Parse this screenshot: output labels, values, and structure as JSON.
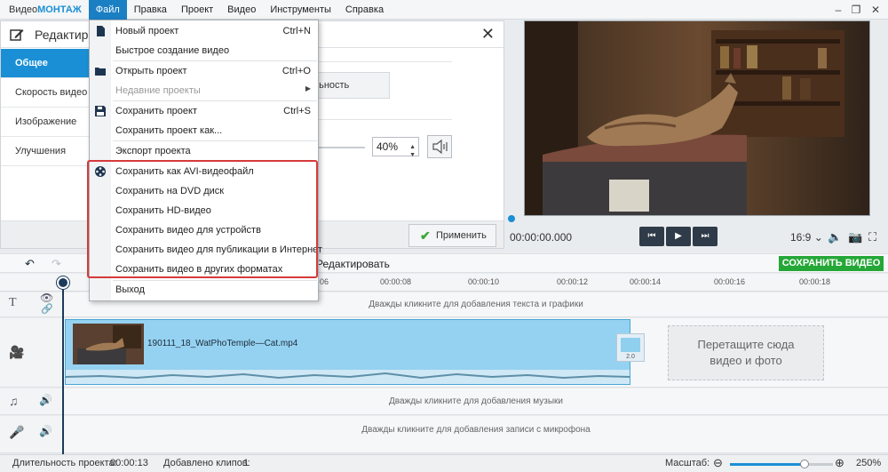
{
  "app": {
    "logo_light": "Видео",
    "logo_bold": "МОНТАЖ"
  },
  "menu": [
    "Файл",
    "Правка",
    "Проект",
    "Видео",
    "Инструменты",
    "Справка"
  ],
  "window": {
    "minimize": "–",
    "maximize": "❐",
    "close": "✕"
  },
  "edit_panel": {
    "title": "Редактиро",
    "close": "✕",
    "sidebar": [
      "Общее",
      "Скорость видео",
      "Изображение",
      "Улучшения"
    ],
    "button_partial": "тельность",
    "percent_value": "40%",
    "apply_label": "Применить"
  },
  "file_menu": {
    "items": [
      {
        "label": "Новый проект",
        "shortcut": "Ctrl+N",
        "icon": "new-file-icon"
      },
      {
        "label": "Быстрое создание видео",
        "shortcut": ""
      },
      {
        "label": "Открыть проект",
        "shortcut": "Ctrl+O",
        "icon": "folder-icon"
      },
      {
        "label": "Недавние проекты",
        "shortcut": "",
        "disabled": true,
        "submenu": true
      },
      {
        "label": "Сохранить проект",
        "shortcut": "Ctrl+S",
        "icon": "save-icon"
      },
      {
        "label": "Сохранить проект как...",
        "shortcut": ""
      },
      {
        "label": "Экспорт проекта",
        "shortcut": ""
      },
      {
        "label": "Сохранить как AVI-видеофайл",
        "shortcut": "",
        "icon": "film-reel-icon"
      },
      {
        "label": "Сохранить на DVD диск",
        "shortcut": ""
      },
      {
        "label": "Сохранить HD-видео",
        "shortcut": ""
      },
      {
        "label": "Сохранить видео для устройств",
        "shortcut": ""
      },
      {
        "label": "Сохранить видео для публикации в Интернет",
        "shortcut": ""
      },
      {
        "label": "Сохранить видео в других форматах",
        "shortcut": ""
      },
      {
        "label": "Выход",
        "shortcut": ""
      }
    ]
  },
  "preview": {
    "time": "00:00:00.000",
    "ratio": "16:9 ⌄"
  },
  "toolbar": {
    "edit_label": "Редактировать",
    "save_video": "СОХРАНИТЬ ВИДЕО"
  },
  "timeline": {
    "ticks": [
      "06",
      "00:00:08",
      "00:00:10",
      "00:00:12",
      "00:00:14",
      "00:00:16",
      "00:00:18"
    ],
    "text_hint": "Дважды кликните для добавления текста и графики",
    "clip_name": "190111_18_WatPhoTemple—Cat.mp4",
    "transition_label": "2.0",
    "drop_hint_1": "Перетащите сюда",
    "drop_hint_2": "видео и фото",
    "music_hint": "Дважды кликните для добавления музыки",
    "mic_hint": "Дважды кликните для добавления записи с микрофона"
  },
  "status": {
    "duration_label": "Длительность проекта:",
    "duration_value": "00:00:13",
    "clips_label": "Добавлено клипов:",
    "clips_value": "1",
    "zoom_label": "Масштаб:",
    "zoom_value": "250%",
    "zoom_level_fraction": 0.72
  },
  "colors": {
    "accent": "#1a8fd5",
    "save_green": "#25a737",
    "highlight_red": "#d63a3a",
    "clip_blue": "#95d2f1"
  }
}
